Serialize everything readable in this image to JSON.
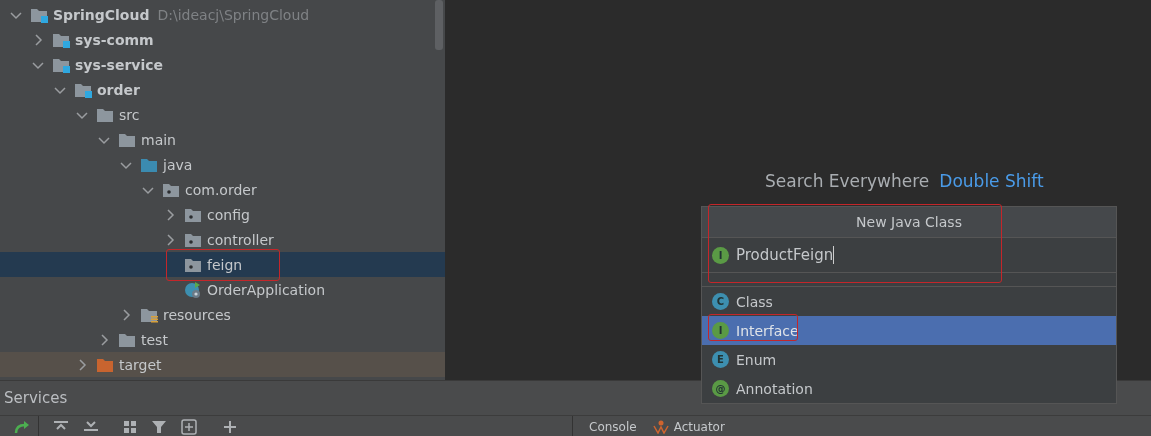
{
  "project_tree": {
    "root": {
      "label": "SpringCloud",
      "path": "D:\\ideacj\\SpringCloud",
      "kind": "module",
      "expanded": true,
      "selected": false,
      "children": [
        {
          "label": "sys-comm",
          "kind": "module",
          "expanded": false,
          "selected": false
        },
        {
          "label": "sys-service",
          "kind": "module",
          "expanded": true,
          "selected": false,
          "children": [
            {
              "label": "order",
              "kind": "module",
              "expanded": true,
              "selected": false,
              "children": [
                {
                  "label": "src",
                  "kind": "folder",
                  "expanded": true,
                  "selected": false,
                  "children": [
                    {
                      "label": "main",
                      "kind": "folder",
                      "expanded": true,
                      "selected": false,
                      "children": [
                        {
                          "label": "java",
                          "kind": "source",
                          "expanded": true,
                          "selected": false,
                          "children": [
                            {
                              "label": "com.order",
                              "kind": "package",
                              "expanded": true,
                              "selected": false,
                              "children": [
                                {
                                  "label": "config",
                                  "kind": "package",
                                  "expanded": false,
                                  "selected": false
                                },
                                {
                                  "label": "controller",
                                  "kind": "package",
                                  "expanded": false,
                                  "selected": false
                                },
                                {
                                  "label": "feign",
                                  "kind": "package",
                                  "selected": true,
                                  "marked": true
                                },
                                {
                                  "label": "OrderApplication",
                                  "kind": "spring-class",
                                  "selected": false
                                }
                              ]
                            }
                          ]
                        },
                        {
                          "label": "resources",
                          "kind": "resources",
                          "expanded": false,
                          "selected": false
                        }
                      ]
                    },
                    {
                      "label": "test",
                      "kind": "folder",
                      "expanded": false,
                      "selected": false
                    }
                  ]
                },
                {
                  "label": "target",
                  "kind": "excluded",
                  "expanded": false,
                  "selected": false
                }
              ]
            }
          ]
        }
      ]
    }
  },
  "editor": {
    "hint": "Search Everywhere",
    "shortcut": "Double Shift"
  },
  "new_class_dialog": {
    "title": "New Java Class",
    "marked": true,
    "name_field": {
      "value": "ProductFeign",
      "badge": "I"
    },
    "items": [
      {
        "label": "Class",
        "badge": "C",
        "color": "#3d8fb0",
        "selected": false,
        "marked": false
      },
      {
        "label": "Interface",
        "badge": "I",
        "color": "#5a9a45",
        "selected": true,
        "marked": true
      },
      {
        "label": "Enum",
        "badge": "E",
        "color": "#3d8fb0",
        "selected": false,
        "marked": false
      },
      {
        "label": "Annotation",
        "badge": "@",
        "color": "#5a9a45",
        "selected": false,
        "marked": false
      }
    ]
  },
  "services": {
    "title": "Services",
    "tabs": [
      {
        "label": "Console",
        "kind": "console"
      },
      {
        "label": "Actuator",
        "kind": "actuator"
      }
    ]
  }
}
